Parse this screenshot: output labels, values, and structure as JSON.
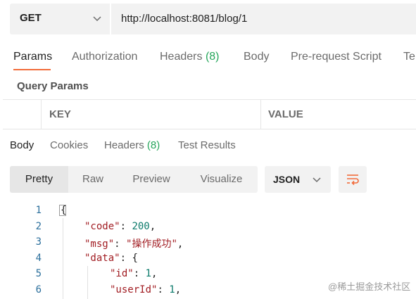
{
  "request": {
    "method": "GET",
    "url": "http://localhost:8081/blog/1"
  },
  "request_tabs": {
    "params": "Params",
    "authorization": "Authorization",
    "headers_label": "Headers",
    "headers_count": "(8)",
    "body": "Body",
    "pre_request": "Pre-request Script",
    "tests_partial": "Te"
  },
  "query_params": {
    "title": "Query Params",
    "col_key": "KEY",
    "col_value": "VALUE"
  },
  "response_tabs": {
    "body": "Body",
    "cookies": "Cookies",
    "headers_label": "Headers",
    "headers_count": "(8)",
    "test_results": "Test Results"
  },
  "response_toolbar": {
    "pretty": "Pretty",
    "raw": "Raw",
    "preview": "Preview",
    "visualize": "Visualize",
    "format": "JSON"
  },
  "code": {
    "line_numbers": [
      "1",
      "2",
      "3",
      "4",
      "5",
      "6"
    ],
    "open_brace": "{",
    "code_key": "\"code\"",
    "code_val": "200",
    "msg_key": "\"msg\"",
    "msg_val": "\"操作成功\"",
    "data_key": "\"data\"",
    "data_open": "{",
    "id_key": "\"id\"",
    "id_val": "1",
    "userid_key": "\"userId\"",
    "userid_val": "1",
    "colon": ": ",
    "comma": ","
  },
  "watermark": "@稀土掘金技术社区",
  "colors": {
    "accent": "#f26b3a",
    "count_green": "#26a65b",
    "json_key": "#a11c22",
    "json_number": "#0b7a6b"
  },
  "icons": {
    "method_dropdown": "chevron-down-icon",
    "format_dropdown": "chevron-down-icon",
    "wrap": "wrap-lines-icon"
  }
}
